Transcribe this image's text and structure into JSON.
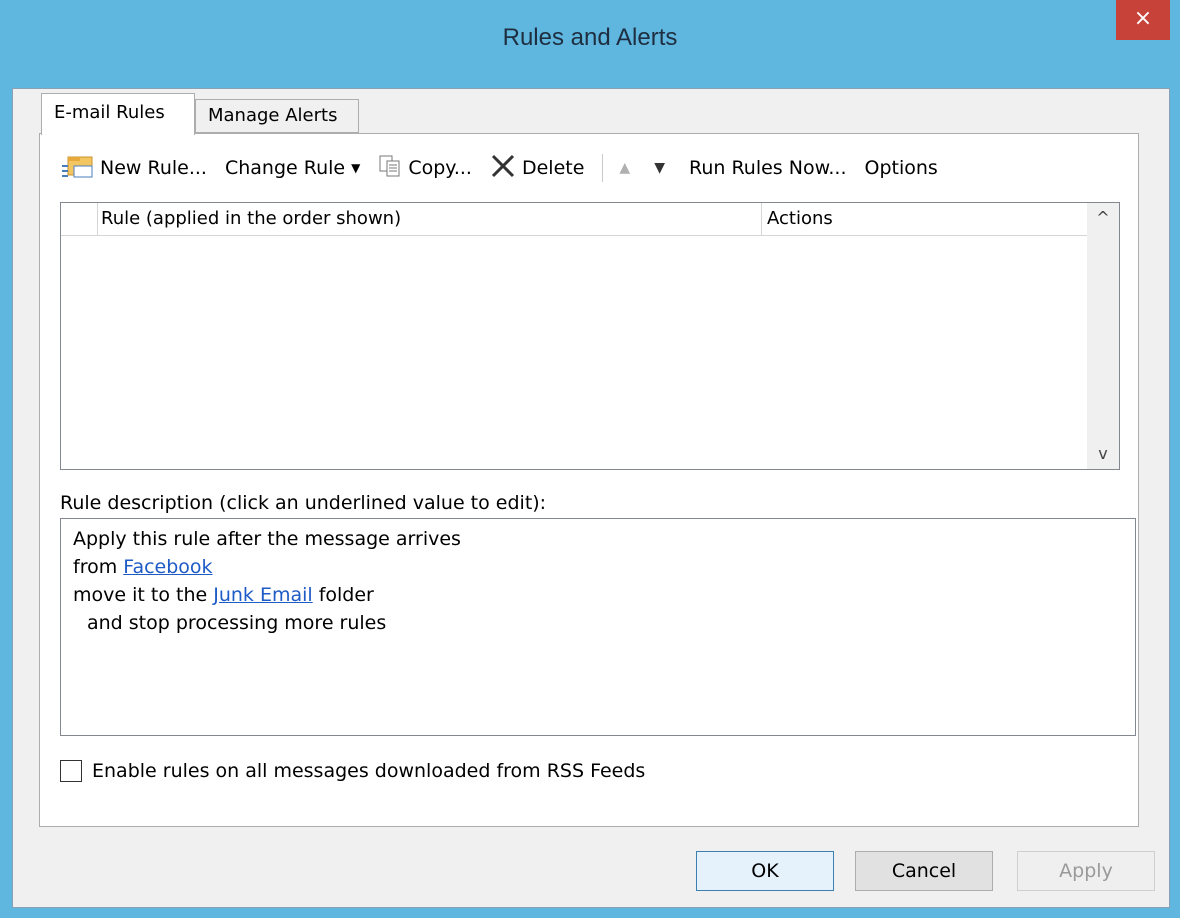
{
  "window": {
    "title": "Rules and Alerts",
    "close_label": "×"
  },
  "tabs": [
    {
      "label": "E-mail Rules",
      "active": true
    },
    {
      "label": "Manage Alerts",
      "active": false
    }
  ],
  "toolbar": {
    "new_rule": "New Rule...",
    "change_rule": "Change Rule",
    "copy": "Copy...",
    "delete": "Delete",
    "run_rules_now": "Run Rules Now...",
    "options": "Options"
  },
  "rules_list": {
    "columns": [
      "Rule (applied in the order shown)",
      "Actions"
    ],
    "rows": []
  },
  "description": {
    "label": "Rule description (click an underlined value to edit):",
    "line1": "Apply this rule after the message arrives",
    "line2_prefix": "from ",
    "line2_link": "Facebook",
    "line3_prefix": "move it to the ",
    "line3_link": "Junk Email",
    "line3_suffix": " folder",
    "line4": "and stop processing more rules"
  },
  "rss": {
    "label": "Enable rules on all messages downloaded from RSS Feeds",
    "checked": false
  },
  "buttons": {
    "ok": "OK",
    "cancel": "Cancel",
    "apply": "Apply"
  },
  "colors": {
    "titlebar": "#5fb6de",
    "close": "#c7433a",
    "link": "#1e5bc6"
  }
}
